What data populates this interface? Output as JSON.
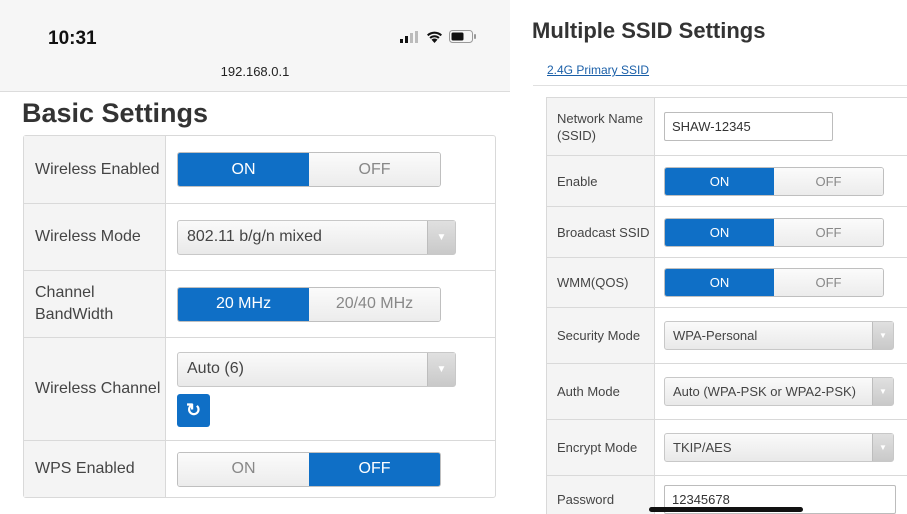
{
  "status": {
    "time": "10:31",
    "url": "192.168.0.1"
  },
  "basic": {
    "title": "Basic Settings",
    "wireless_enabled": {
      "label": "Wireless Enabled",
      "on": "ON",
      "off": "OFF",
      "selected": "ON"
    },
    "wireless_mode": {
      "label": "Wireless Mode",
      "value": "802.11 b/g/n mixed"
    },
    "channel_bandwidth": {
      "label": "Channel BandWidth",
      "opt1": "20 MHz",
      "opt2": "20/40 MHz",
      "selected": "20 MHz"
    },
    "wireless_channel": {
      "label": "Wireless Channel",
      "value": "Auto (6)"
    },
    "wps_enabled": {
      "label": "WPS Enabled",
      "on": "ON",
      "off": "OFF",
      "selected": "OFF"
    }
  },
  "multi": {
    "title": "Multiple SSID Settings",
    "link": "2.4G Primary SSID",
    "network_name": {
      "label": "Network Name (SSID)",
      "value": "SHAW-12345"
    },
    "enable": {
      "label": "Enable",
      "on": "ON",
      "off": "OFF",
      "selected": "ON"
    },
    "broadcast_ssid": {
      "label": "Broadcast SSID",
      "on": "ON",
      "off": "OFF",
      "selected": "ON"
    },
    "wmm": {
      "label": "WMM(QOS)",
      "on": "ON",
      "off": "OFF",
      "selected": "ON"
    },
    "security_mode": {
      "label": "Security Mode",
      "value": "WPA-Personal"
    },
    "auth_mode": {
      "label": "Auth Mode",
      "value": "Auto (WPA-PSK or WPA2-PSK)"
    },
    "encrypt_mode": {
      "label": "Encrypt Mode",
      "value": "TKIP/AES"
    },
    "password": {
      "label": "Password",
      "value": "12345678"
    }
  },
  "colors": {
    "accent": "#0f6fc6",
    "link": "#1a5fa8"
  },
  "icons": {
    "signal": "signal-bars-icon",
    "wifi": "wifi-icon",
    "battery": "battery-icon",
    "refresh": "refresh-icon",
    "dropdown": "chevron-down-icon"
  }
}
